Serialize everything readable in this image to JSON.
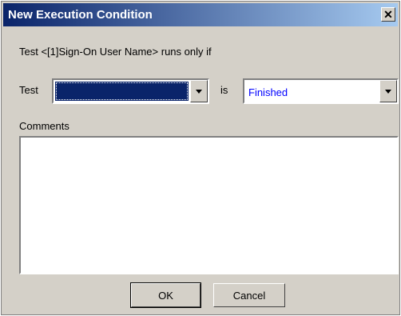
{
  "dialog": {
    "title": "New Execution Condition",
    "close_glyph": "✕",
    "condition_text": "Test  <[1]Sign-On User Name>  runs only if",
    "test_label": "Test",
    "test_value": "",
    "is_label": "is",
    "status_value": "Finished",
    "comments_label": "Comments",
    "comments_value": "",
    "ok_label": "OK",
    "cancel_label": "Cancel"
  },
  "colors": {
    "title_bar_start": "#0a246a",
    "title_bar_end": "#a6caf0",
    "face": "#d4d0c8",
    "selection": "#0a246a",
    "status_text": "#0000ff"
  },
  "icons": {
    "close": "close-icon",
    "dropdown": "chevron-down-icon"
  }
}
